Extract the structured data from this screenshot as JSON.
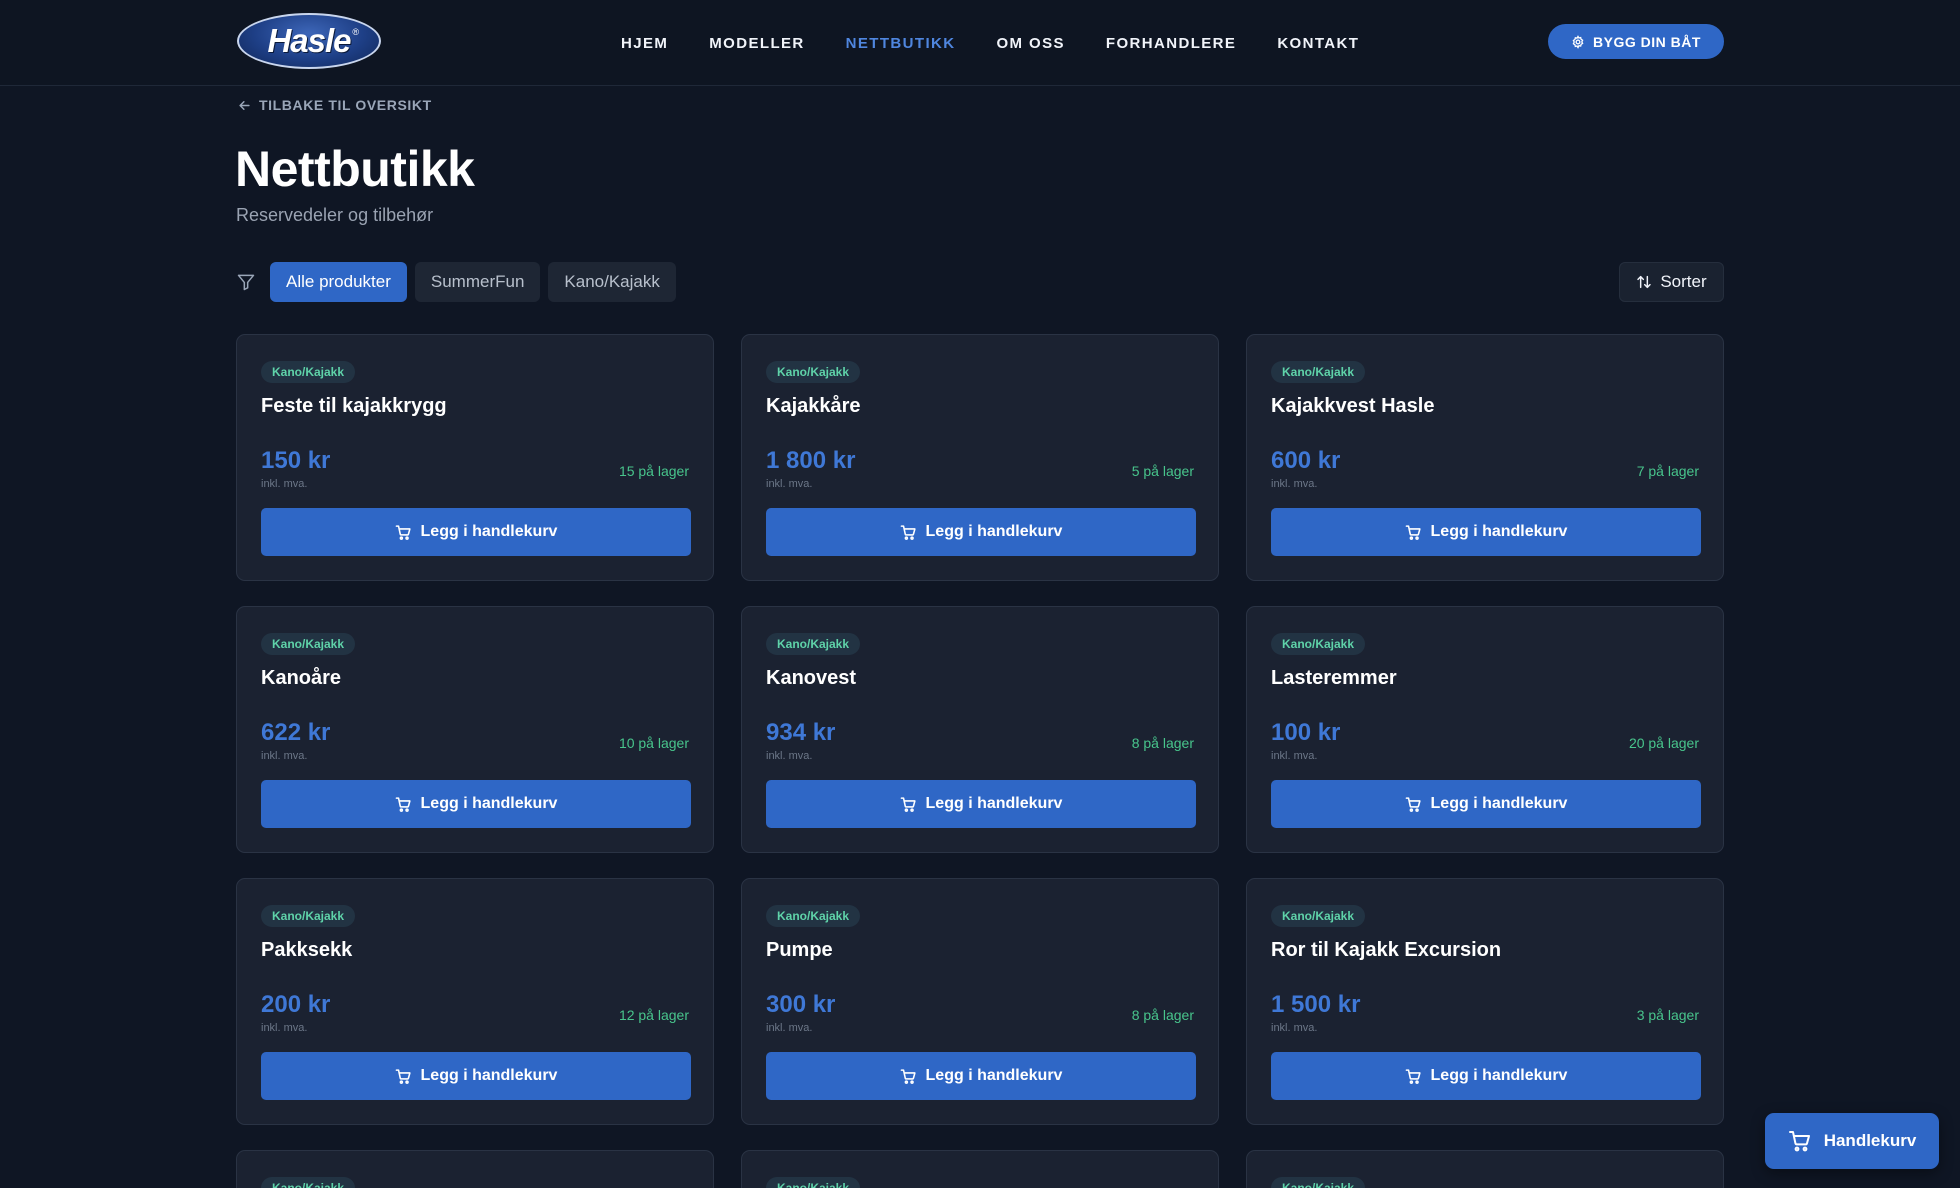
{
  "brand": {
    "logo_text": "Hasle",
    "reg_mark": "®"
  },
  "nav": {
    "items": [
      {
        "label": "HJEM",
        "name": "nav-hjem",
        "active": false
      },
      {
        "label": "MODELLER",
        "name": "nav-modeller",
        "active": false
      },
      {
        "label": "NETTBUTIKK",
        "name": "nav-nettbutikk",
        "active": true
      },
      {
        "label": "OM OSS",
        "name": "nav-om-oss",
        "active": false
      },
      {
        "label": "FORHANDLERE",
        "name": "nav-forhandlere",
        "active": false
      },
      {
        "label": "KONTAKT",
        "name": "nav-kontakt",
        "active": false
      }
    ],
    "cta_label": "BYGG DIN BÅT",
    "cta_icon": "gear-icon"
  },
  "page": {
    "back_label": "TILBAKE TIL OVERSIKT",
    "title": "Nettbutikk",
    "subtitle": "Reservedeler og tilbehør"
  },
  "filters": {
    "chips": [
      {
        "label": "Alle produkter",
        "active": true
      },
      {
        "label": "SummerFun",
        "active": false
      },
      {
        "label": "Kano/Kajakk",
        "active": false
      }
    ],
    "sort_label": "Sorter"
  },
  "products": [
    {
      "category": "Kano/Kajakk",
      "name": "Feste til kajakkrygg",
      "price": "150 kr",
      "vat": "inkl. mva.",
      "stock": "15 på lager",
      "button": "Legg i handlekurv"
    },
    {
      "category": "Kano/Kajakk",
      "name": "Kajakkåre",
      "price": "1 800 kr",
      "vat": "inkl. mva.",
      "stock": "5 på lager",
      "button": "Legg i handlekurv"
    },
    {
      "category": "Kano/Kajakk",
      "name": "Kajakkvest Hasle",
      "price": "600 kr",
      "vat": "inkl. mva.",
      "stock": "7 på lager",
      "button": "Legg i handlekurv"
    },
    {
      "category": "Kano/Kajakk",
      "name": "Kanoåre",
      "price": "622 kr",
      "vat": "inkl. mva.",
      "stock": "10 på lager",
      "button": "Legg i handlekurv"
    },
    {
      "category": "Kano/Kajakk",
      "name": "Kanovest",
      "price": "934 kr",
      "vat": "inkl. mva.",
      "stock": "8 på lager",
      "button": "Legg i handlekurv"
    },
    {
      "category": "Kano/Kajakk",
      "name": "Lasteremmer",
      "price": "100 kr",
      "vat": "inkl. mva.",
      "stock": "20 på lager",
      "button": "Legg i handlekurv"
    },
    {
      "category": "Kano/Kajakk",
      "name": "Pakksekk",
      "price": "200 kr",
      "vat": "inkl. mva.",
      "stock": "12 på lager",
      "button": "Legg i handlekurv"
    },
    {
      "category": "Kano/Kajakk",
      "name": "Pumpe",
      "price": "300 kr",
      "vat": "inkl. mva.",
      "stock": "8 på lager",
      "button": "Legg i handlekurv"
    },
    {
      "category": "Kano/Kajakk",
      "name": "Ror til Kajakk Excursion",
      "price": "1 500 kr",
      "vat": "inkl. mva.",
      "stock": "3 på lager",
      "button": "Legg i handlekurv"
    }
  ],
  "partial_products": [
    {
      "category": "Kano/Kajakk"
    },
    {
      "category": "Kano/Kajakk"
    },
    {
      "category": "Kano/Kajakk"
    }
  ],
  "cart": {
    "label": "Handlekurv",
    "icon": "cart-icon"
  },
  "colors": {
    "accent": "#2f67c6",
    "background": "#0f1624",
    "card": "#1b2231",
    "badge_text": "#5fd3a9",
    "stock": "#48c58c",
    "price": "#3f78d6"
  }
}
